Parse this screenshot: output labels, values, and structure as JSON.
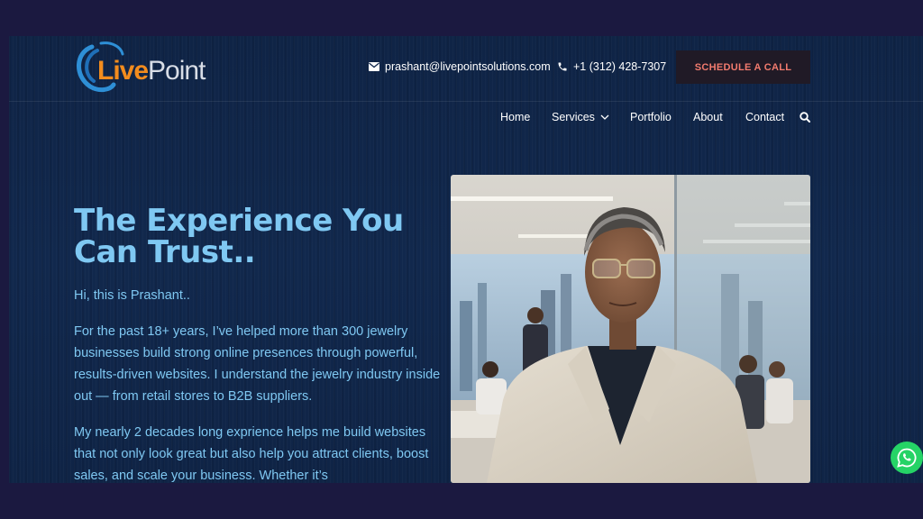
{
  "logo": {
    "part1": "Live",
    "part2": "Point"
  },
  "header": {
    "email": "prashant@livepointsolutions.com",
    "phone": "+1 (312) 428-7307",
    "cta": "SCHEDULE A CALL"
  },
  "nav": {
    "items": [
      {
        "label": "Home"
      },
      {
        "label": "Services"
      },
      {
        "label": "Portfolio"
      },
      {
        "label": "About"
      },
      {
        "label": "Contact"
      }
    ]
  },
  "hero": {
    "title": "The Experience You Can Trust..",
    "greeting": "Hi, this is Prashant..",
    "para1": "For the past 18+ years, I’ve helped more than 300 jewelry businesses build strong online presences through powerful, results-driven websites. I understand the jewelry industry inside out — from retail stores to B2B suppliers.",
    "para2": "My nearly 2 decades long exprience helps me build websites that not only look great but also help you attract clients, boost sales, and scale your business. Whether it’s"
  },
  "icons": {
    "email": "envelope-icon",
    "phone": "phone-icon",
    "dropdown": "chevron-down-icon",
    "search": "search-icon",
    "whatsapp": "whatsapp-icon"
  },
  "colors": {
    "background": "#0f2446",
    "accent_text": "#7fc8f2",
    "cta_text": "#f27b6e",
    "logo_orange": "#f28c1e"
  }
}
